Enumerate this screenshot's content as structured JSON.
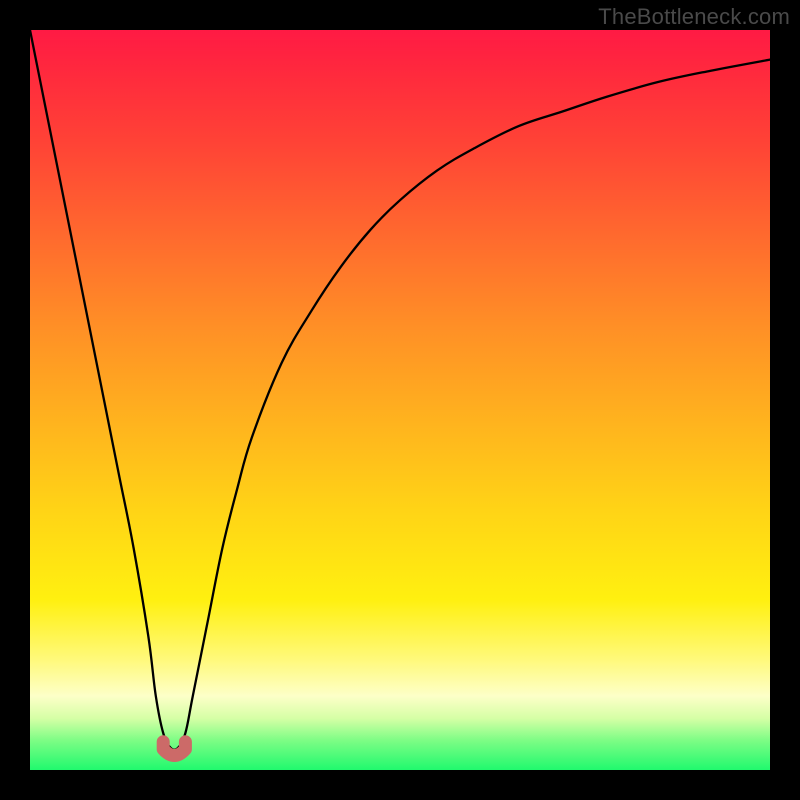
{
  "watermark": "TheBottleneck.com",
  "chart_data": {
    "type": "line",
    "title": "",
    "xlabel": "",
    "ylabel": "",
    "xlim": [
      0,
      100
    ],
    "ylim": [
      0,
      100
    ],
    "series": [
      {
        "name": "bottleneck-curve",
        "x": [
          0,
          2,
          4,
          6,
          8,
          10,
          12,
          14,
          16,
          17,
          18,
          19,
          20,
          21,
          22,
          24,
          26,
          28,
          30,
          34,
          38,
          42,
          46,
          50,
          55,
          60,
          66,
          72,
          78,
          85,
          92,
          100
        ],
        "y": [
          100,
          90,
          80,
          70,
          60,
          50,
          40,
          30,
          18,
          10,
          5,
          3,
          3,
          5,
          10,
          20,
          30,
          38,
          45,
          55,
          62,
          68,
          73,
          77,
          81,
          84,
          87,
          89,
          91,
          93,
          94.5,
          96
        ]
      }
    ],
    "marker": {
      "name": "optimal-region",
      "x": [
        18,
        21
      ],
      "y": [
        3,
        3
      ]
    },
    "colors": {
      "curve": "#000000",
      "marker": "#cc6a68",
      "gradient_top": "#ff1a44",
      "gradient_bottom": "#20f96e"
    }
  }
}
